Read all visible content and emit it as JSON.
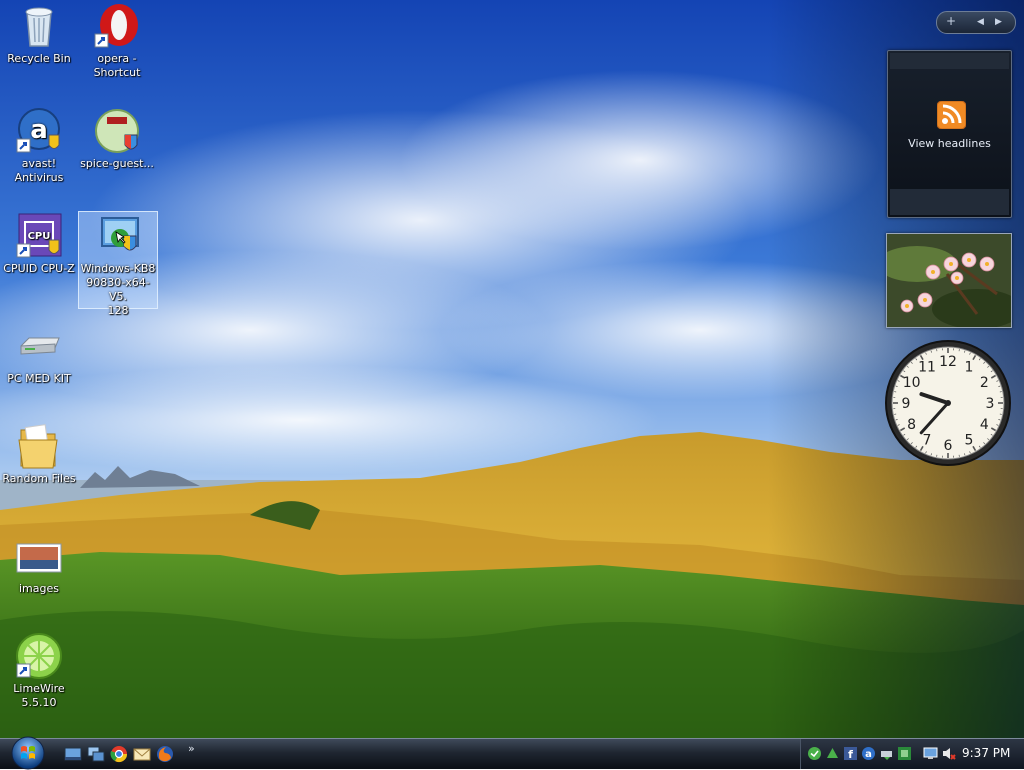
{
  "desktop": {
    "icons": [
      {
        "label": "Recycle Bin",
        "icon": "recycle-bin-icon"
      },
      {
        "label": "opera - Shortcut",
        "icon": "opera-icon"
      },
      {
        "label": "avast! Antivirus",
        "icon": "avast-icon"
      },
      {
        "label": "spice-guest...",
        "icon": "spice-guest-icon"
      },
      {
        "label": "CPUID CPU-Z",
        "icon": "cpuz-icon"
      },
      {
        "label": "Windows-KB890830-x64-V5.128",
        "label_lines": [
          "Windows-KB8",
          "90830-x64-V5.",
          "128"
        ],
        "icon": "windows-update-icon",
        "selected": true
      },
      {
        "label": "PC MED KIT",
        "icon": "drive-icon"
      },
      {
        "label": "Random Files",
        "icon": "folder-icon"
      },
      {
        "label": "images",
        "icon": "images-icon"
      },
      {
        "label": "LimeWire 5.5.10",
        "icon": "limewire-icon"
      }
    ]
  },
  "sidebar": {
    "controls": {
      "add": "+",
      "prev": "◀",
      "next": "▶"
    },
    "feed_gadget": {
      "label": "View headlines",
      "icon": "rss-icon"
    },
    "slideshow_gadget": {
      "icon": "flowers-photo"
    },
    "clock_gadget": {
      "numbers": [
        "12",
        "1",
        "2",
        "3",
        "4",
        "5",
        "6",
        "7",
        "8",
        "9",
        "10",
        "11"
      ],
      "hour": 9,
      "minute": 37
    }
  },
  "taskbar": {
    "start": {
      "icon": "windows-start-orb"
    },
    "quick_launch": [
      "show-desktop-icon",
      "switch-windows-icon",
      "chrome-icon",
      "mail-icon",
      "firefox-icon"
    ],
    "more_label": "»",
    "tray_icons": [
      "green-shield-icon",
      "network-icon",
      "facebook-icon",
      "avast-tray-icon",
      "safely-remove-icon",
      "update-icon",
      "display-icon",
      "volume-muted-icon"
    ],
    "clock": "9:37 PM"
  },
  "colors": {
    "sky_top": "#1a4fb8",
    "grass_gold": "#d4a22a",
    "shrub_green": "#3e7a1e",
    "taskbar": "#1f2631",
    "rss_orange": "#f08a24"
  }
}
